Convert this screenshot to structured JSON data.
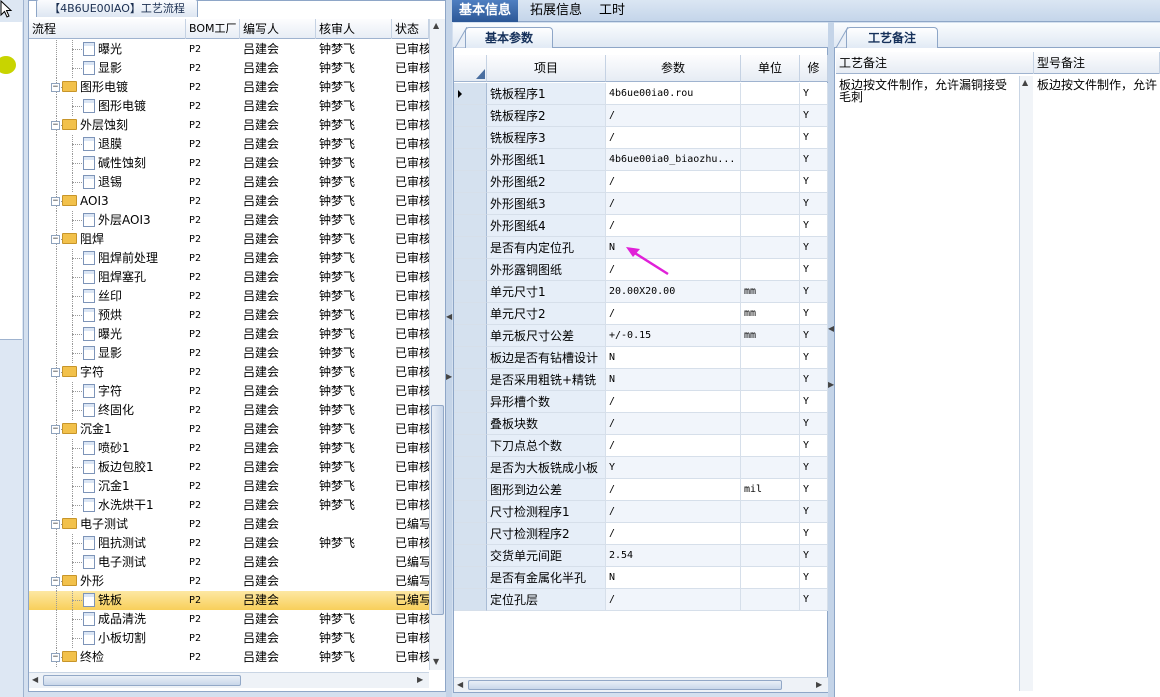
{
  "left_panel": {
    "window_tab": "【4B6UE00IAO】工艺流程",
    "columns": [
      "流程",
      "BOM工厂",
      "编写人",
      "核审人",
      "状态"
    ],
    "rows": [
      {
        "level": 2,
        "kind": "doc",
        "name": "曝光",
        "bom": "P2",
        "author": "吕建会",
        "reviewer": "钟梦飞",
        "status": "已审核"
      },
      {
        "level": 2,
        "kind": "doc",
        "name": "显影",
        "bom": "P2",
        "author": "吕建会",
        "reviewer": "钟梦飞",
        "status": "已审核"
      },
      {
        "level": 1,
        "kind": "folder",
        "name": "图形电镀",
        "bom": "P2",
        "author": "吕建会",
        "reviewer": "钟梦飞",
        "status": "已审核"
      },
      {
        "level": 2,
        "kind": "doc",
        "name": "图形电镀",
        "bom": "P2",
        "author": "吕建会",
        "reviewer": "钟梦飞",
        "status": "已审核"
      },
      {
        "level": 1,
        "kind": "folder",
        "name": "外层蚀刻",
        "bom": "P2",
        "author": "吕建会",
        "reviewer": "钟梦飞",
        "status": "已审核"
      },
      {
        "level": 2,
        "kind": "doc",
        "name": "退膜",
        "bom": "P2",
        "author": "吕建会",
        "reviewer": "钟梦飞",
        "status": "已审核"
      },
      {
        "level": 2,
        "kind": "doc",
        "name": "碱性蚀刻",
        "bom": "P2",
        "author": "吕建会",
        "reviewer": "钟梦飞",
        "status": "已审核"
      },
      {
        "level": 2,
        "kind": "doc",
        "name": "退锡",
        "bom": "P2",
        "author": "吕建会",
        "reviewer": "钟梦飞",
        "status": "已审核"
      },
      {
        "level": 1,
        "kind": "folder",
        "name": "AOI3",
        "bom": "P2",
        "author": "吕建会",
        "reviewer": "钟梦飞",
        "status": "已审核"
      },
      {
        "level": 2,
        "kind": "doc",
        "name": "外层AOI3",
        "bom": "P2",
        "author": "吕建会",
        "reviewer": "钟梦飞",
        "status": "已审核"
      },
      {
        "level": 1,
        "kind": "folder",
        "name": "阻焊",
        "bom": "P2",
        "author": "吕建会",
        "reviewer": "钟梦飞",
        "status": "已审核"
      },
      {
        "level": 2,
        "kind": "doc",
        "name": "阻焊前处理",
        "bom": "P2",
        "author": "吕建会",
        "reviewer": "钟梦飞",
        "status": "已审核"
      },
      {
        "level": 2,
        "kind": "doc",
        "name": "阻焊塞孔",
        "bom": "P2",
        "author": "吕建会",
        "reviewer": "钟梦飞",
        "status": "已审核"
      },
      {
        "level": 2,
        "kind": "doc",
        "name": "丝印",
        "bom": "P2",
        "author": "吕建会",
        "reviewer": "钟梦飞",
        "status": "已审核"
      },
      {
        "level": 2,
        "kind": "doc",
        "name": "预烘",
        "bom": "P2",
        "author": "吕建会",
        "reviewer": "钟梦飞",
        "status": "已审核"
      },
      {
        "level": 2,
        "kind": "doc",
        "name": "曝光",
        "bom": "P2",
        "author": "吕建会",
        "reviewer": "钟梦飞",
        "status": "已审核"
      },
      {
        "level": 2,
        "kind": "doc",
        "name": "显影",
        "bom": "P2",
        "author": "吕建会",
        "reviewer": "钟梦飞",
        "status": "已审核"
      },
      {
        "level": 1,
        "kind": "folder",
        "name": "字符",
        "bom": "P2",
        "author": "吕建会",
        "reviewer": "钟梦飞",
        "status": "已审核"
      },
      {
        "level": 2,
        "kind": "doc",
        "name": "字符",
        "bom": "P2",
        "author": "吕建会",
        "reviewer": "钟梦飞",
        "status": "已审核"
      },
      {
        "level": 2,
        "kind": "doc",
        "name": "终固化",
        "bom": "P2",
        "author": "吕建会",
        "reviewer": "钟梦飞",
        "status": "已审核"
      },
      {
        "level": 1,
        "kind": "folder",
        "name": "沉金1",
        "bom": "P2",
        "author": "吕建会",
        "reviewer": "钟梦飞",
        "status": "已审核"
      },
      {
        "level": 2,
        "kind": "doc",
        "name": "喷砂1",
        "bom": "P2",
        "author": "吕建会",
        "reviewer": "钟梦飞",
        "status": "已审核"
      },
      {
        "level": 2,
        "kind": "doc",
        "name": "板边包胶1",
        "bom": "P2",
        "author": "吕建会",
        "reviewer": "钟梦飞",
        "status": "已审核"
      },
      {
        "level": 2,
        "kind": "doc",
        "name": "沉金1",
        "bom": "P2",
        "author": "吕建会",
        "reviewer": "钟梦飞",
        "status": "已审核"
      },
      {
        "level": 2,
        "kind": "doc",
        "name": "水洗烘干1",
        "bom": "P2",
        "author": "吕建会",
        "reviewer": "钟梦飞",
        "status": "已审核"
      },
      {
        "level": 1,
        "kind": "folder",
        "name": "电子测试",
        "bom": "P2",
        "author": "吕建会",
        "reviewer": "",
        "status": "已编写"
      },
      {
        "level": 2,
        "kind": "doc",
        "name": "阻抗测试",
        "bom": "P2",
        "author": "吕建会",
        "reviewer": "钟梦飞",
        "status": "已审核"
      },
      {
        "level": 2,
        "kind": "doc",
        "name": "电子测试",
        "bom": "P2",
        "author": "吕建会",
        "reviewer": "",
        "status": "已编写"
      },
      {
        "level": 1,
        "kind": "folder",
        "name": "外形",
        "bom": "P2",
        "author": "吕建会",
        "reviewer": "",
        "status": "已编写"
      },
      {
        "level": 2,
        "kind": "doc",
        "name": "铣板",
        "bom": "P2",
        "author": "吕建会",
        "reviewer": "",
        "status": "已编写",
        "selected": true
      },
      {
        "level": 2,
        "kind": "doc",
        "name": "成品清洗",
        "bom": "P2",
        "author": "吕建会",
        "reviewer": "钟梦飞",
        "status": "已审核"
      },
      {
        "level": 2,
        "kind": "doc",
        "name": "小板切割",
        "bom": "P2",
        "author": "吕建会",
        "reviewer": "钟梦飞",
        "status": "已审核"
      },
      {
        "level": 1,
        "kind": "folder",
        "name": "终检",
        "bom": "P2",
        "author": "吕建会",
        "reviewer": "钟梦飞",
        "status": "已审核"
      }
    ]
  },
  "top_tabs": [
    "基本信息",
    "拓展信息",
    "工时"
  ],
  "middle": {
    "sub_tab": "基本参数",
    "columns": [
      "项目",
      "参数",
      "单位",
      "修"
    ],
    "rows": [
      {
        "item": "铣板程序1",
        "value": "4b6ue00ia0.rou",
        "unit": "",
        "flag": "Y",
        "current": true
      },
      {
        "item": "铣板程序2",
        "value": "/",
        "unit": "",
        "flag": "Y"
      },
      {
        "item": "铣板程序3",
        "value": "/",
        "unit": "",
        "flag": "Y"
      },
      {
        "item": "外形图纸1",
        "value": "4b6ue00ia0_biaozhu...",
        "unit": "",
        "flag": "Y"
      },
      {
        "item": "外形图纸2",
        "value": "/",
        "unit": "",
        "flag": "Y"
      },
      {
        "item": "外形图纸3",
        "value": "/",
        "unit": "",
        "flag": "Y"
      },
      {
        "item": "外形图纸4",
        "value": "/",
        "unit": "",
        "flag": "Y"
      },
      {
        "item": "是否有内定位孔",
        "value": "N",
        "unit": "",
        "flag": "Y"
      },
      {
        "item": "外形露铜图纸",
        "value": "/",
        "unit": "",
        "flag": "Y"
      },
      {
        "item": "单元尺寸1",
        "value": "20.00X20.00",
        "unit": "mm",
        "flag": "Y"
      },
      {
        "item": "单元尺寸2",
        "value": "/",
        "unit": "mm",
        "flag": "Y"
      },
      {
        "item": "单元板尺寸公差",
        "value": "+/-0.15",
        "unit": "mm",
        "flag": "Y"
      },
      {
        "item": "板边是否有钻槽设计",
        "value": "N",
        "unit": "",
        "flag": "Y"
      },
      {
        "item": "是否采用粗铣+精铣",
        "value": "N",
        "unit": "",
        "flag": "Y"
      },
      {
        "item": "异形槽个数",
        "value": "/",
        "unit": "",
        "flag": "Y"
      },
      {
        "item": "叠板块数",
        "value": "/",
        "unit": "",
        "flag": "Y"
      },
      {
        "item": "下刀点总个数",
        "value": "/",
        "unit": "",
        "flag": "Y"
      },
      {
        "item": "是否为大板铣成小板",
        "value": "Y",
        "unit": "",
        "flag": "Y"
      },
      {
        "item": "图形到边公差",
        "value": "/",
        "unit": "mil",
        "flag": "Y"
      },
      {
        "item": "尺寸检测程序1",
        "value": "/",
        "unit": "",
        "flag": "Y"
      },
      {
        "item": "尺寸检测程序2",
        "value": "/",
        "unit": "",
        "flag": "Y"
      },
      {
        "item": "交货单元间距",
        "value": "2.54",
        "unit": "",
        "flag": "Y"
      },
      {
        "item": "是否有金属化半孔",
        "value": "N",
        "unit": "",
        "flag": "Y"
      },
      {
        "item": "定位孔层",
        "value": "/",
        "unit": "",
        "flag": "Y"
      }
    ]
  },
  "right": {
    "tab": "工艺备注",
    "col1": "工艺备注",
    "col2": "型号备注",
    "note1": "板边按文件制作，允许漏铜接受毛刺",
    "note2": "板边按文件制作，允许"
  },
  "colors": {
    "accent_tab": "#3a67a8",
    "selected_row": "#f8cf5a",
    "annotation_arrow": "#e020d8"
  }
}
